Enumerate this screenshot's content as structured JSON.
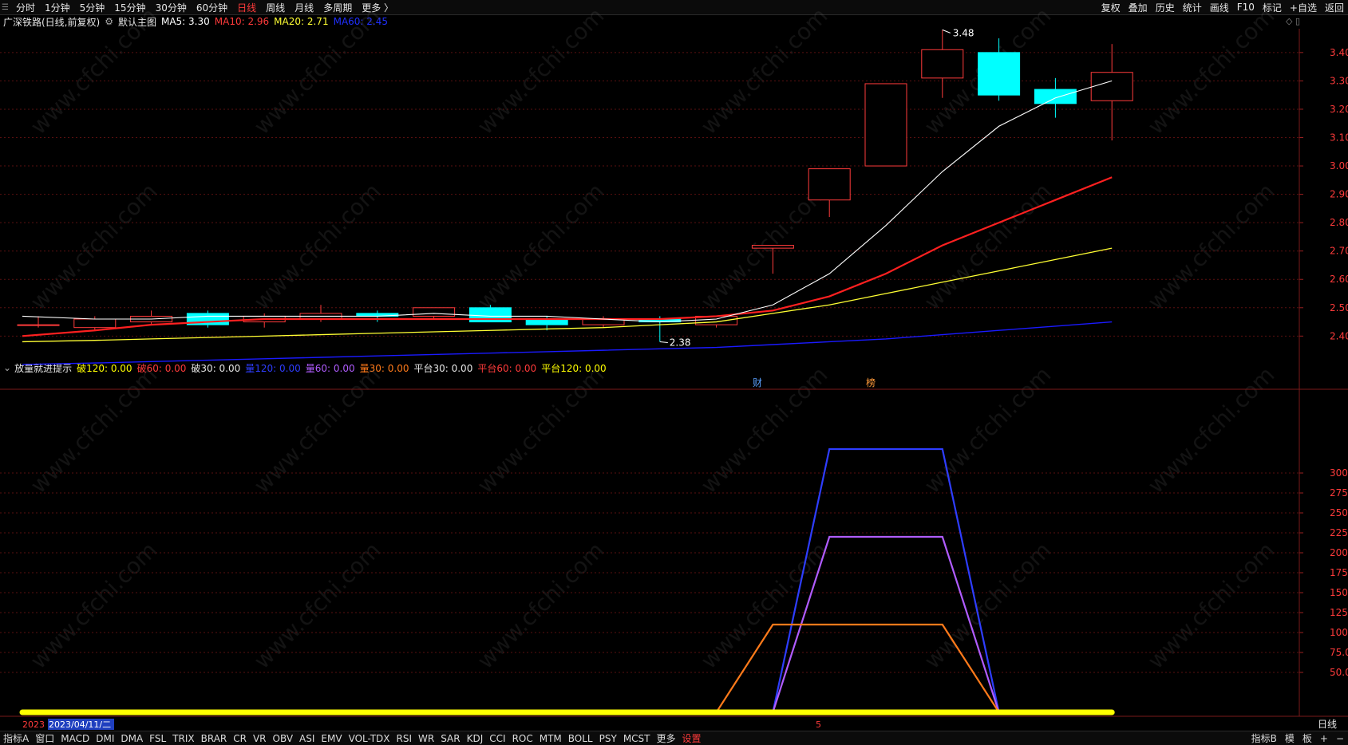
{
  "topbar": {
    "left_items": [
      "分时",
      "1分钟",
      "5分钟",
      "15分钟",
      "30分钟",
      "60分钟",
      "日线",
      "周线",
      "月线",
      "多周期",
      "更多 〉"
    ],
    "active_index": 6,
    "right_items": [
      "复权",
      "叠加",
      "历史",
      "统计",
      "画线",
      "F10",
      "标记",
      "+自选",
      "返回"
    ]
  },
  "main_info": {
    "title": "广深铁路(日线,前复权)",
    "chart_label": "默认主图",
    "ma5": "MA5: 3.30",
    "ma10": "MA10: 2.96",
    "ma20": "MA20: 2.71",
    "ma60": "MA60: 2.45"
  },
  "indicator_info": {
    "title": "放量就进提示",
    "items": [
      {
        "label": "破120: 0.00",
        "color": "#ffff00"
      },
      {
        "label": "破60: 0.00",
        "color": "#ff3b3b"
      },
      {
        "label": "破30: 0.00",
        "color": "#e6e6e6"
      },
      {
        "label": "量120: 0.00",
        "color": "#2e3dff"
      },
      {
        "label": "量60: 0.00",
        "color": "#b05cff"
      },
      {
        "label": "量30: 0.00",
        "color": "#ff7a1a"
      },
      {
        "label": "平台30: 0.00",
        "color": "#e6e6e6"
      },
      {
        "label": "平台60: 0.00",
        "color": "#ff3b3b"
      },
      {
        "label": "平台120: 0.00",
        "color": "#ffff00"
      }
    ]
  },
  "bottombar": {
    "tabs": [
      "指标A",
      "窗口",
      "MACD",
      "DMI",
      "DMA",
      "FSL",
      "TRIX",
      "BRAR",
      "CR",
      "VR",
      "OBV",
      "ASI",
      "EMV",
      "VOL-TDX",
      "RSI",
      "WR",
      "SAR",
      "KDJ",
      "CCI",
      "ROC",
      "MTM",
      "BOLL",
      "PSY",
      "MCST",
      "更多",
      "设置"
    ],
    "active_tab": "设置",
    "right_tabs": [
      "指标B",
      "模",
      "板",
      "+",
      "−"
    ]
  },
  "time_axis": {
    "date_label": "2023/04/11/二",
    "year_label": "2023",
    "month_marker": "5",
    "right_label": "日线"
  },
  "markers": {
    "cai": "财",
    "bang": "榜",
    "high_label": "3.48",
    "low_label": "2.38"
  },
  "colors": {
    "up": "#ff3b3b",
    "down": "#00ffff",
    "ma5": "#ffffff",
    "ma10": "#ff2020",
    "ma20": "#ffff33",
    "ma60": "#1a1aff",
    "vol120": "#2e3dff",
    "vol60": "#b05cff",
    "vol30": "#ff7a1a",
    "baseline": "#ffff00"
  },
  "chart_data": [
    {
      "type": "candlestick",
      "title": "广深铁路(日线,前复权)",
      "y_ticks": [
        2.4,
        2.5,
        2.6,
        2.7,
        2.8,
        2.9,
        3.0,
        3.1,
        3.2,
        3.3,
        3.4
      ],
      "ylim": [
        2.28,
        3.52
      ],
      "candles": [
        {
          "o": 2.44,
          "c": 2.44,
          "h": 2.47,
          "l": 2.43
        },
        {
          "o": 2.43,
          "c": 2.46,
          "h": 2.47,
          "l": 2.42
        },
        {
          "o": 2.45,
          "c": 2.47,
          "h": 2.49,
          "l": 2.44
        },
        {
          "o": 2.48,
          "c": 2.44,
          "h": 2.49,
          "l": 2.43
        },
        {
          "o": 2.45,
          "c": 2.47,
          "h": 2.48,
          "l": 2.43
        },
        {
          "o": 2.46,
          "c": 2.48,
          "h": 2.51,
          "l": 2.45
        },
        {
          "o": 2.48,
          "c": 2.47,
          "h": 2.49,
          "l": 2.45
        },
        {
          "o": 2.47,
          "c": 2.5,
          "h": 2.5,
          "l": 2.46
        },
        {
          "o": 2.5,
          "c": 2.45,
          "h": 2.51,
          "l": 2.45
        },
        {
          "o": 2.46,
          "c": 2.44,
          "h": 2.47,
          "l": 2.42
        },
        {
          "o": 2.44,
          "c": 2.46,
          "h": 2.47,
          "l": 2.43
        },
        {
          "o": 2.46,
          "c": 2.45,
          "h": 2.47,
          "l": 2.38
        },
        {
          "o": 2.44,
          "c": 2.47,
          "h": 2.47,
          "l": 2.43
        },
        {
          "o": 2.71,
          "c": 2.72,
          "h": 2.72,
          "l": 2.62
        },
        {
          "o": 2.88,
          "c": 2.99,
          "h": 2.99,
          "l": 2.82
        },
        {
          "o": 3.0,
          "c": 3.29,
          "h": 3.29,
          "l": 3.0
        },
        {
          "o": 3.31,
          "c": 3.41,
          "h": 3.48,
          "l": 3.24
        },
        {
          "o": 3.4,
          "c": 3.25,
          "h": 3.45,
          "l": 3.23
        },
        {
          "o": 3.27,
          "c": 3.22,
          "h": 3.31,
          "l": 3.17
        },
        {
          "o": 3.23,
          "c": 3.33,
          "h": 3.43,
          "l": 3.09
        }
      ],
      "ma5": [
        2.47,
        2.46,
        2.46,
        2.47,
        2.47,
        2.47,
        2.47,
        2.48,
        2.47,
        2.47,
        2.46,
        2.45,
        2.46,
        2.51,
        2.62,
        2.79,
        2.98,
        3.14,
        3.24,
        3.3
      ],
      "ma10": [
        2.4,
        2.42,
        2.44,
        2.45,
        2.46,
        2.46,
        2.46,
        2.46,
        2.46,
        2.46,
        2.46,
        2.46,
        2.47,
        2.49,
        2.54,
        2.62,
        2.72,
        2.8,
        2.88,
        2.96
      ],
      "ma20": [
        2.38,
        2.385,
        2.39,
        2.395,
        2.4,
        2.405,
        2.41,
        2.415,
        2.42,
        2.425,
        2.43,
        2.44,
        2.45,
        2.48,
        2.51,
        2.55,
        2.59,
        2.63,
        2.67,
        2.71
      ],
      "ma60": [
        2.3,
        2.305,
        2.31,
        2.315,
        2.32,
        2.325,
        2.33,
        2.335,
        2.34,
        2.345,
        2.35,
        2.355,
        2.36,
        2.37,
        2.38,
        2.39,
        2.405,
        2.42,
        2.435,
        2.45
      ]
    },
    {
      "type": "line",
      "title": "放量就进提示",
      "y_ticks": [
        50,
        75,
        100,
        125,
        150,
        175,
        200,
        225,
        250,
        275,
        300
      ],
      "ylim": [
        0,
        345
      ],
      "series": [
        {
          "name": "量120",
          "values": [
            0,
            0,
            0,
            0,
            0,
            0,
            0,
            0,
            0,
            0,
            0,
            0,
            0,
            0,
            330,
            330,
            330,
            0,
            0,
            0
          ]
        },
        {
          "name": "量60",
          "values": [
            0,
            0,
            0,
            0,
            0,
            0,
            0,
            0,
            0,
            0,
            0,
            0,
            0,
            0,
            220,
            220,
            220,
            0,
            0,
            0
          ]
        },
        {
          "name": "量30",
          "values": [
            0,
            0,
            0,
            0,
            0,
            0,
            0,
            0,
            0,
            0,
            0,
            0,
            0,
            110,
            110,
            110,
            110,
            0,
            0,
            0
          ]
        }
      ]
    }
  ]
}
